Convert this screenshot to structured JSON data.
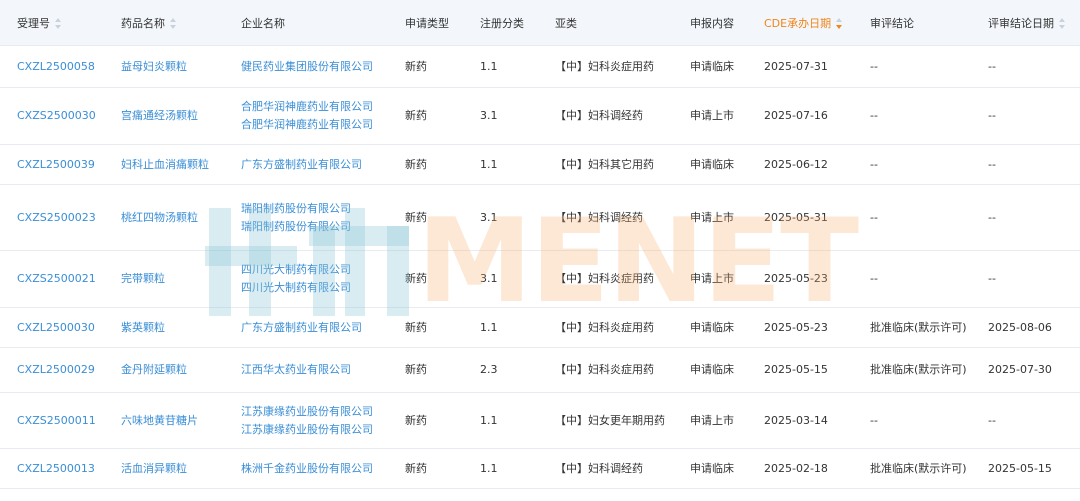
{
  "columns": [
    {
      "label": "受理号",
      "sortable": true,
      "state": "none"
    },
    {
      "label": "药品名称",
      "sortable": true,
      "state": "none"
    },
    {
      "label": "企业名称",
      "sortable": false
    },
    {
      "label": "申请类型",
      "sortable": false
    },
    {
      "label": "注册分类",
      "sortable": false
    },
    {
      "label": "亚类",
      "sortable": false
    },
    {
      "label": "申报内容",
      "sortable": false
    },
    {
      "label": "CDE承办日期",
      "sortable": true,
      "state": "desc"
    },
    {
      "label": "审评结论",
      "sortable": false
    },
    {
      "label": "评审结论日期",
      "sortable": true,
      "state": "none"
    }
  ],
  "rows": [
    {
      "id": "CXZL2500058",
      "drug": "益母妇炎颗粒",
      "companies": [
        "健民药业集团股份有限公司"
      ],
      "type": "新药",
      "category": "1.1",
      "subclass": "【中】妇科炎症用药",
      "content": "申请临床",
      "date": "2025-07-31",
      "conclusion": "--",
      "conclusion_date": "--"
    },
    {
      "id": "CXZS2500030",
      "drug": "宫痛通经汤颗粒",
      "companies": [
        "合肥华润神鹿药业有限公司",
        "合肥华润神鹿药业有限公司"
      ],
      "type": "新药",
      "category": "3.1",
      "subclass": "【中】妇科调经药",
      "content": "申请上市",
      "date": "2025-07-16",
      "conclusion": "--",
      "conclusion_date": "--"
    },
    {
      "id": "CXZL2500039",
      "drug": "妇科止血消痛颗粒",
      "companies": [
        "广东方盛制药业有限公司"
      ],
      "type": "新药",
      "category": "1.1",
      "subclass": "【中】妇科其它用药",
      "content": "申请临床",
      "date": "2025-06-12",
      "conclusion": "--",
      "conclusion_date": "--"
    },
    {
      "id": "CXZS2500023",
      "drug": "桃红四物汤颗粒",
      "companies": [
        "瑞阳制药股份有限公司",
        "瑞阳制药股份有限公司"
      ],
      "type": "新药",
      "category": "3.1",
      "subclass": "【中】妇科调经药",
      "content": "申请上市",
      "date": "2025-05-31",
      "conclusion": "--",
      "conclusion_date": "--"
    },
    {
      "id": "CXZS2500021",
      "drug": "完带颗粒",
      "companies": [
        "四川光大制药有限公司",
        "四川光大制药有限公司"
      ],
      "type": "新药",
      "category": "3.1",
      "subclass": "【中】妇科炎症用药",
      "content": "申请上市",
      "date": "2025-05-23",
      "conclusion": "--",
      "conclusion_date": "--"
    },
    {
      "id": "CXZL2500030",
      "drug": "紫英颗粒",
      "companies": [
        "广东方盛制药业有限公司"
      ],
      "type": "新药",
      "category": "1.1",
      "subclass": "【中】妇科炎症用药",
      "content": "申请临床",
      "date": "2025-05-23",
      "conclusion": "批准临床(默示许可)",
      "conclusion_date": "2025-08-06"
    },
    {
      "id": "CXZL2500029",
      "drug": "金丹附延颗粒",
      "companies": [
        "江西华太药业有限公司"
      ],
      "type": "新药",
      "category": "2.3",
      "subclass": "【中】妇科炎症用药",
      "content": "申请临床",
      "date": "2025-05-15",
      "conclusion": "批准临床(默示许可)",
      "conclusion_date": "2025-07-30"
    },
    {
      "id": "CXZS2500011",
      "drug": "六味地黄苷糖片",
      "companies": [
        "江苏康缘药业股份有限公司",
        "江苏康缘药业股份有限公司"
      ],
      "type": "新药",
      "category": "1.1",
      "subclass": "【中】妇女更年期用药",
      "content": "申请上市",
      "date": "2025-03-14",
      "conclusion": "--",
      "conclusion_date": "--"
    },
    {
      "id": "CXZL2500013",
      "drug": "活血消异颗粒",
      "companies": [
        "株洲千金药业股份有限公司"
      ],
      "type": "新药",
      "category": "1.1",
      "subclass": "【中】妇科调经药",
      "content": "申请临床",
      "date": "2025-02-18",
      "conclusion": "批准临床(默示许可)",
      "conclusion_date": "2025-05-15"
    }
  ],
  "watermark": {
    "latin": "MENET"
  },
  "colors": {
    "header_bg": "#f3f7fb",
    "link": "#3a8ed6",
    "active_sort": "#f08519",
    "watermark_blue": "#89c4d6",
    "watermark_orange": "#f8ab68"
  }
}
